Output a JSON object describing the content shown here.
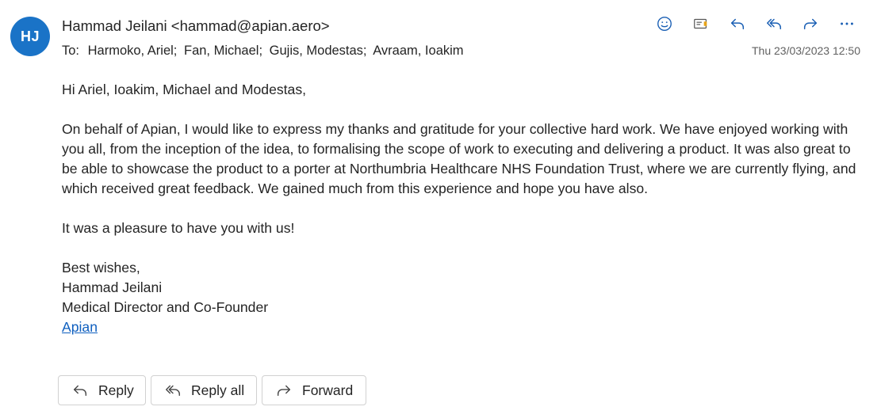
{
  "header": {
    "avatar_initials": "HJ",
    "avatar_color": "#1a73c7",
    "sender": "Hammad Jeilani <hammad@apian.aero>",
    "to_label": "To:",
    "recipients": [
      "Harmoko, Ariel;",
      "Fan, Michael;",
      "Gujis, Modestas;",
      "Avraam, Ioakim"
    ],
    "timestamp": "Thu 23/03/2023 12:50"
  },
  "toolbar_icons": [
    "emoji-icon",
    "flag-icon",
    "reply-icon",
    "reply-all-icon",
    "forward-icon",
    "more-icon"
  ],
  "accent_color": "#1a73c7",
  "body": {
    "greeting": "Hi Ariel, Ioakim, Michael and Modestas,",
    "paragraph": "On behalf of Apian, I would like to express my thanks and gratitude for your collective hard work. We have enjoyed working with you all, from the inception of the idea, to formalising the scope of work to executing and delivering a product. It was also great to be able to showcase the product to a porter at Northumbria Healthcare NHS Foundation Trust, where we are currently flying, and which received great feedback. We gained much from this experience and hope you have also.",
    "closing_line": "It was a pleasure to have you with us!",
    "signoff": "Best wishes,",
    "sig_name": "Hammad Jeilani",
    "sig_title": "Medical Director and Co-Founder",
    "sig_link": "Apian"
  },
  "buttons": {
    "reply": "Reply",
    "reply_all": "Reply all",
    "forward": "Forward"
  }
}
